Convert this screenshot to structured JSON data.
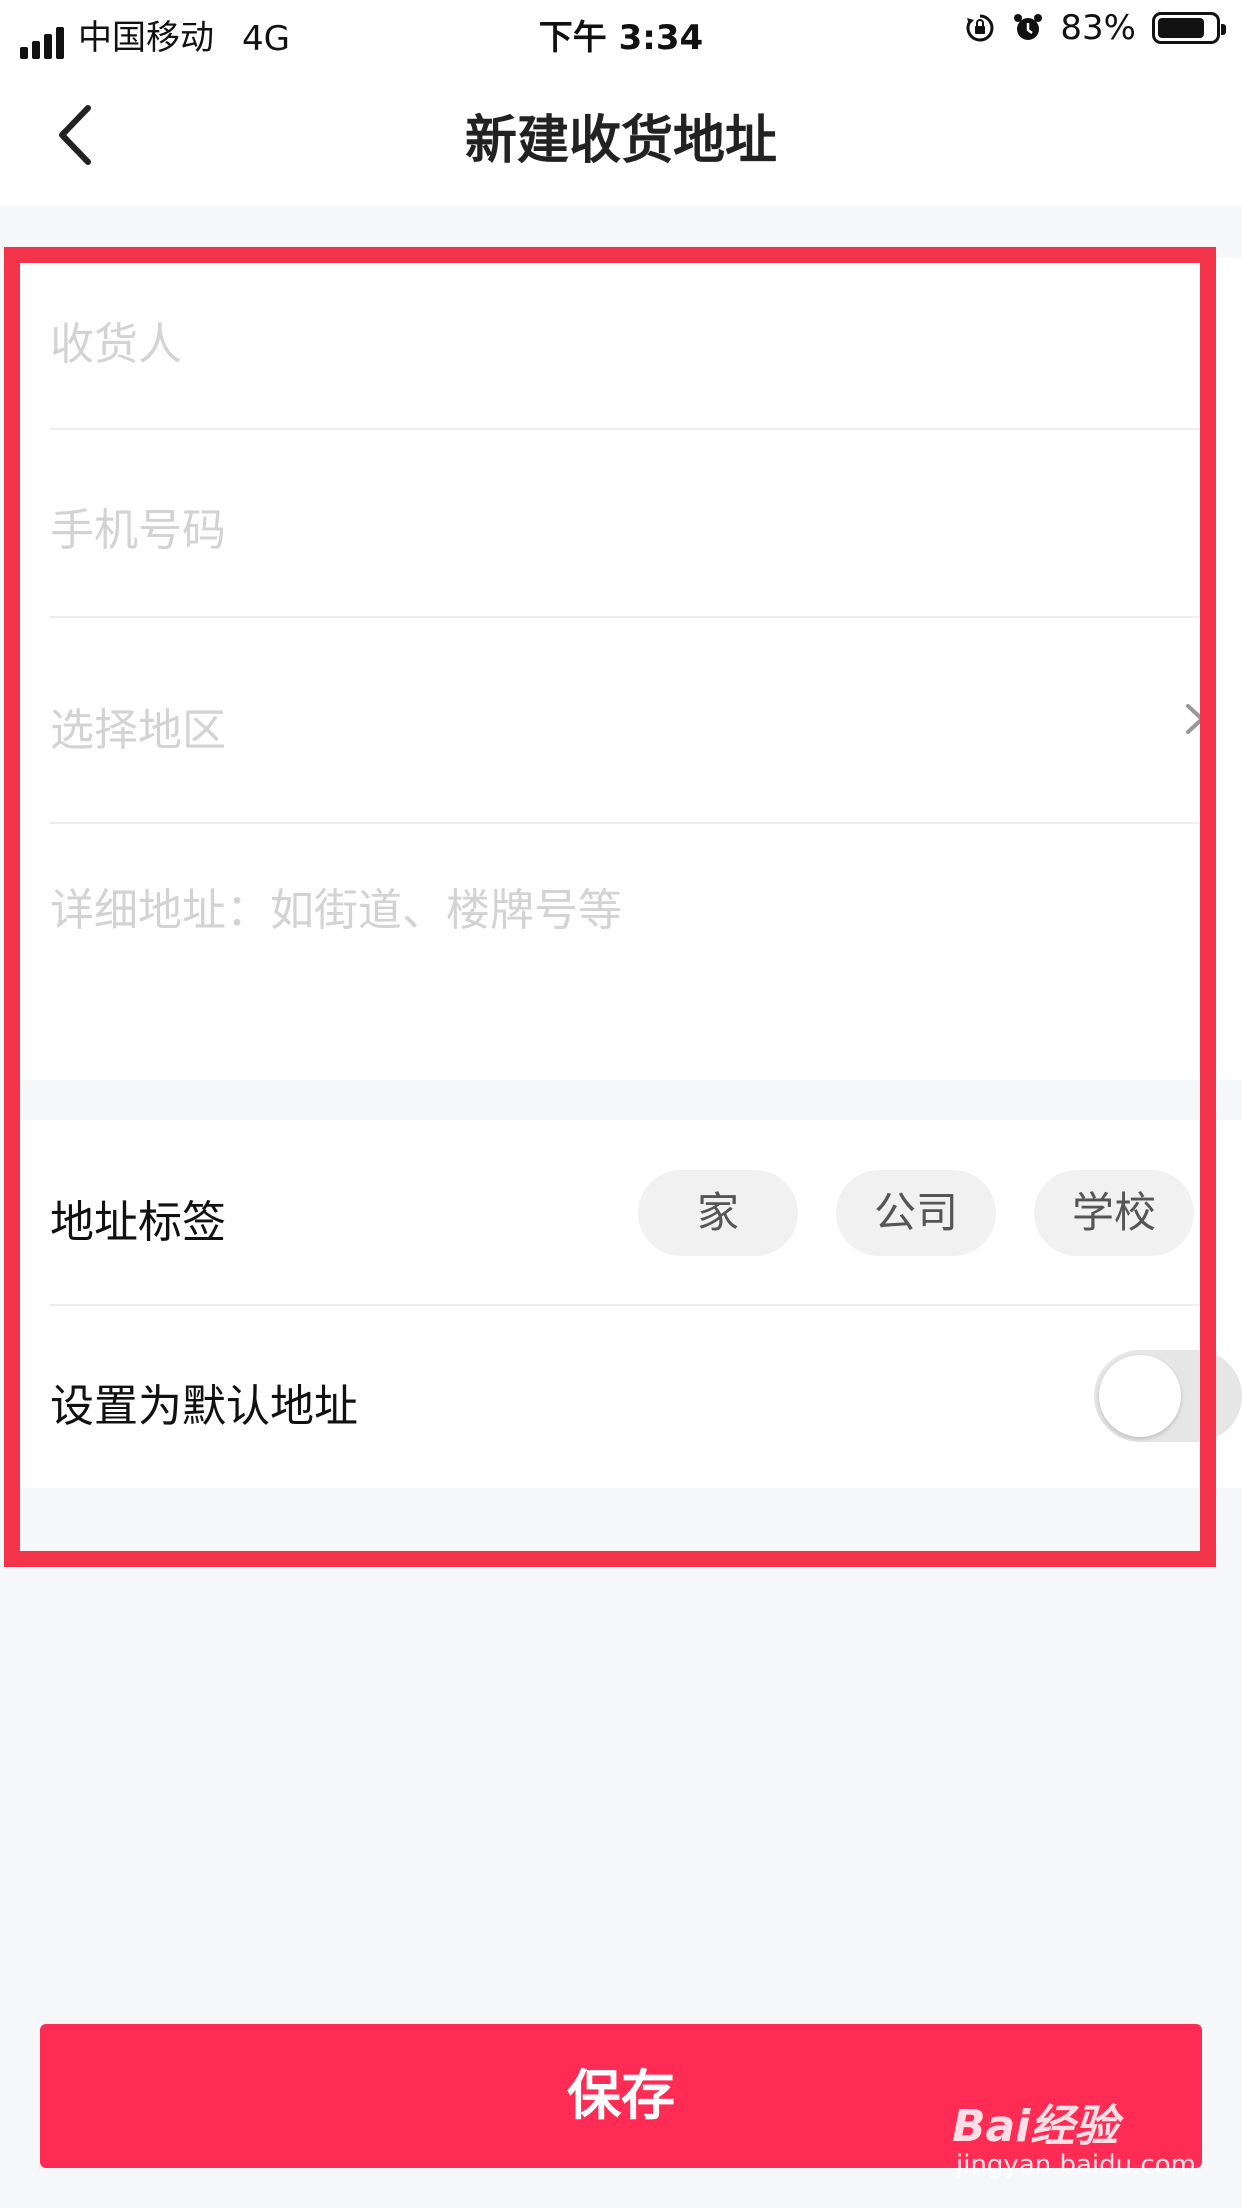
{
  "status_bar": {
    "carrier": "中国移动",
    "network": "4G",
    "time": "下午 3:34",
    "battery": "83%",
    "battery_level": 0.83,
    "icons": [
      "signal-icon",
      "rotation-lock-icon",
      "alarm-icon",
      "battery-icon"
    ]
  },
  "nav": {
    "title": "新建收货地址",
    "back_icon": "chevron-left-icon"
  },
  "form": {
    "recipient_placeholder": "收货人",
    "phone_placeholder": "手机号码",
    "region_placeholder": "选择地区",
    "detail_placeholder": "详细地址：如街道、楼牌号等"
  },
  "tags": {
    "label": "地址标签",
    "options": [
      "家",
      "公司",
      "学校"
    ]
  },
  "default_address": {
    "label": "设置为默认地址",
    "enabled": false
  },
  "save_label": "保存",
  "watermark": {
    "brand": "Bai经验",
    "url": "jingyan.baidu.com"
  },
  "colors": {
    "accent": "#fe2c55",
    "highlight": "#f23349",
    "background": "#f6f7f9",
    "placeholder": "#d3d3d3"
  }
}
